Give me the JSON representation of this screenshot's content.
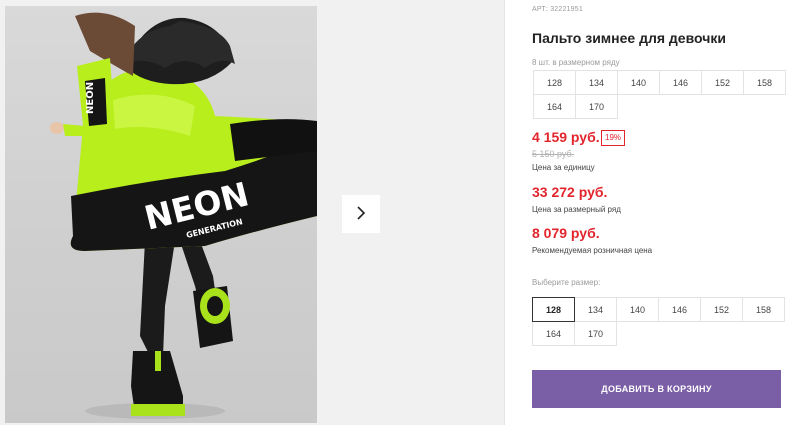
{
  "product": {
    "article": "АРТ: 32221951",
    "title": "Пальто зимнее для девочки",
    "range_caption": "8 шт. в размерном ряду",
    "range_sizes": [
      "128",
      "134",
      "140",
      "146",
      "152",
      "158",
      "164",
      "170"
    ],
    "price": "4 159 руб.",
    "discount": "19%",
    "old_price": "5 150 руб.",
    "price_caption": "Цена за единицу",
    "range_price": "33 272 руб.",
    "range_price_caption": "Цена за размерный ряд",
    "retail_price": "8 079 руб.",
    "retail_price_caption": "Рекомендуемая розничная цена",
    "choose_caption": "Выберите размер:",
    "select_sizes": [
      "128",
      "134",
      "140",
      "146",
      "152",
      "158",
      "164",
      "170"
    ],
    "selected_size": "128",
    "add_to_cart": "ДОБАВИТЬ В КОРЗИНУ"
  },
  "photo": {
    "jacket_text": "NEON",
    "jacket_subtext": "GENERATION",
    "sleeve_text": "NEON"
  },
  "colors": {
    "accent": "#7b5fa6",
    "price_red": "#e2252d",
    "neon": "#b8ee1c"
  },
  "icons": {
    "next": "chevron-right-icon"
  }
}
